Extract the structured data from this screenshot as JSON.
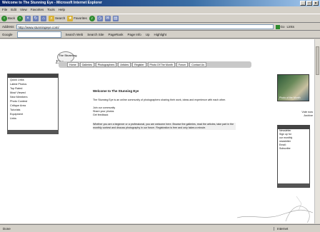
{
  "window": {
    "title": "Welcome to The Stunning Eye - Microsoft Internet Explorer",
    "controls": [
      "_",
      "□",
      "×"
    ]
  },
  "menu": [
    "File",
    "Edit",
    "View",
    "Favorites",
    "Tools",
    "Help"
  ],
  "toolbar": {
    "back": "Back",
    "forward": "",
    "stop": "",
    "refresh": "",
    "home": "",
    "search": "Search",
    "favorites": "Favorites",
    "media": "",
    "history": "",
    "mail": "",
    "print": ""
  },
  "address": {
    "label": "Address",
    "value": "http://www.stunningeye.com/",
    "go": "Go",
    "links": "Links"
  },
  "links_bar": {
    "label": "Google",
    "items": [
      "Search Web",
      "Search Site",
      "PageRank",
      "Page Info",
      "Up",
      "Highlight"
    ]
  },
  "site": {
    "logo_top": "The Stunning",
    "logo_script": "Eye",
    "nav": [
      "Home",
      "Galleries",
      "Photographers",
      "Articles",
      "Register",
      "Photo Of The Month",
      "Forum",
      "Contact Us"
    ]
  },
  "sidebar": {
    "rows": [
      "Quick Links",
      "Latest Photos",
      "Top Rated",
      "Most Viewed",
      "New Members",
      "Photo Contest",
      "Critique Area",
      "Tutorials",
      "Equipment",
      "Links"
    ]
  },
  "main": {
    "heading": "Welcome to The Stunning Eye",
    "intro": "The Stunning Eye is an online community of photographers sharing their work, ideas and experience with each other.",
    "list": [
      "Join our community",
      "Share your photos",
      "Get feedback"
    ],
    "body": "Whether you are a beginner or a professional, you are welcome here. Browse the galleries, read the articles, take part in the monthly contest and discuss photography in our forum. Registration is free and only takes a minute."
  },
  "right": {
    "image_caption": "Photo of the Month",
    "links": [
      "Vote now",
      "Archive"
    ],
    "box_rows": [
      "Newsletter",
      "Sign up for",
      "our monthly",
      "newsletter",
      "",
      "Email:",
      "",
      "Subscribe"
    ]
  },
  "status": {
    "left": "Done",
    "right": "Internet"
  }
}
